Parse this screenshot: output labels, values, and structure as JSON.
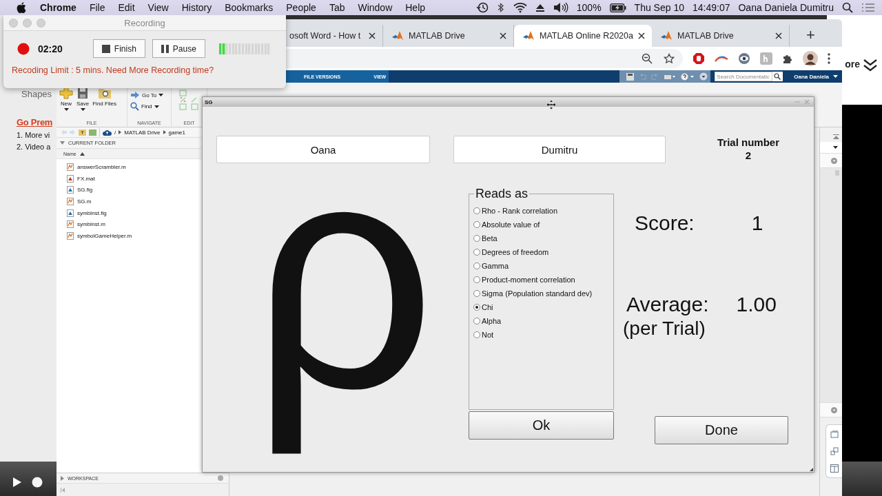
{
  "menubar": {
    "app": "Chrome",
    "menus": [
      "File",
      "Edit",
      "View",
      "History",
      "Bookmarks",
      "People",
      "Tab",
      "Window",
      "Help"
    ],
    "battery": "100%",
    "date": "Thu Sep 10",
    "time": "14:49:07",
    "user": "Oana Daniela Dumitru"
  },
  "background_page": {
    "heading": "Shapes",
    "link": "Go Prem",
    "items": [
      "1. More vi",
      "2. Video a"
    ]
  },
  "behind_window": {
    "text": "ore"
  },
  "recording": {
    "title": "Recording",
    "elapsed": "02:20",
    "buttons": [
      {
        "label": "Finish",
        "kind": "stop"
      },
      {
        "label": "Pause",
        "kind": "pause"
      }
    ],
    "level": 0.125,
    "notice": "Recoding Limit : 5 mins. Need More Recording time?"
  },
  "browser": {
    "tabs": [
      {
        "label": "osoft Word - How t",
        "icon": false,
        "selected": false
      },
      {
        "label": "MATLAB Drive",
        "icon": true,
        "selected": false
      },
      {
        "label": "MATLAB Online R2020a",
        "icon": true,
        "selected": true
      },
      {
        "label": "MATLAB Drive",
        "icon": true,
        "selected": false
      }
    ],
    "new_tab": "+"
  },
  "matlab": {
    "toolstrip_tabs": [
      "FILE VERSIONS",
      "VIEW"
    ],
    "search": {
      "placeholder": "Search Documentatic"
    },
    "user": "Oana Daniela",
    "sections": [
      {
        "label": "FILE",
        "tools": [
          {
            "label": "New",
            "kind": "new"
          },
          {
            "label": "Save",
            "kind": "save"
          },
          {
            "label": "Find Files",
            "kind": "findfiles"
          }
        ]
      },
      {
        "label": "NAVIGATE",
        "tools": [
          {
            "label": "Go To",
            "kind": "goto"
          },
          {
            "label": "Find",
            "kind": "find"
          }
        ]
      },
      {
        "label": "EDIT"
      }
    ],
    "path": [
      "/",
      "MATLAB Drive",
      "game1"
    ],
    "current_folder": {
      "title": "CURRENT FOLDER",
      "column": "Name",
      "files": [
        {
          "name": "answerScrambler.m",
          "kind": "m"
        },
        {
          "name": "FX.mat",
          "kind": "mat"
        },
        {
          "name": "SG.fig",
          "kind": "fig"
        },
        {
          "name": "SG.m",
          "kind": "m"
        },
        {
          "name": "symbInst.fig",
          "kind": "fig"
        },
        {
          "name": "symbInst.m",
          "kind": "m"
        },
        {
          "name": "symbolGameHelper.m",
          "kind": "m"
        }
      ]
    },
    "workspace": "WORKSPACE"
  },
  "figure": {
    "title": "SG",
    "first_name": "Oana",
    "last_name": "Dumitru",
    "trial_label": "Trial number",
    "trial": "2",
    "symbol": "ρ",
    "group_title": "Reads as",
    "options": [
      {
        "label": "Rho - Rank correlation",
        "selected": false
      },
      {
        "label": "Absolute value of",
        "selected": false
      },
      {
        "label": "Beta",
        "selected": false
      },
      {
        "label": "Degrees of freedom",
        "selected": false
      },
      {
        "label": "Gamma",
        "selected": false
      },
      {
        "label": "Product-moment correlation",
        "selected": false
      },
      {
        "label": "Sigma (Population standard dev)",
        "selected": false
      },
      {
        "label": "Chi",
        "selected": true
      },
      {
        "label": "Alpha",
        "selected": false
      },
      {
        "label": "Not",
        "selected": false
      }
    ],
    "score_label": "Score:",
    "score": "1",
    "average_label": "Average:",
    "average": "1.00",
    "average_note": "(per Trial)",
    "buttons": [
      "Ok",
      "Done"
    ]
  }
}
